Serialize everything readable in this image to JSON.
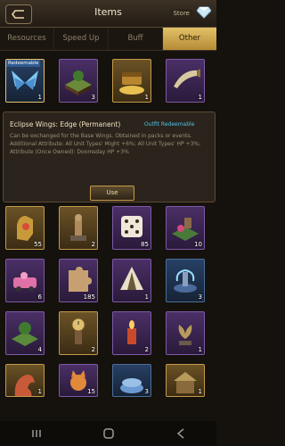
{
  "header": {
    "title": "Items",
    "store_label": "Store"
  },
  "tabs": [
    {
      "label": "Resources",
      "active": false
    },
    {
      "label": "Speed Up",
      "active": false
    },
    {
      "label": "Buff",
      "active": false
    },
    {
      "label": "Other",
      "active": true
    }
  ],
  "top_row": [
    {
      "name": "eclipse-wings-item",
      "count": "1",
      "badge": "Redeemable",
      "style": "blue",
      "icon": "wings-icon"
    },
    {
      "name": "island-decoration-item",
      "count": "3",
      "style": "purple",
      "icon": "island-icon"
    },
    {
      "name": "treasure-chest-item",
      "count": "1",
      "style": "gold",
      "icon": "treasure-icon"
    },
    {
      "name": "horn-item",
      "count": "1",
      "style": "purple",
      "icon": "horn-icon"
    }
  ],
  "detail": {
    "title": "Eclipse Wings: Edge (Permanent)",
    "badge": "Outfit Redeemable",
    "description": "Can be exchanged for the Base Wings. Obtained in packs or events.",
    "attributes": "Additional Attribute: All Unit Types' Might +6%; All Unit Types' HP +3%; Attribute (Once Owned): Doomsday HP +3%",
    "use_label": "Use"
  },
  "grid": [
    {
      "name": "gauntlet-item",
      "count": "55",
      "style": "gold",
      "icon": "gauntlet-icon"
    },
    {
      "name": "bunny-statue-item",
      "count": "2",
      "style": "gold",
      "icon": "statue-icon"
    },
    {
      "name": "dice-item",
      "count": "85",
      "style": "purple",
      "icon": "dice-icon"
    },
    {
      "name": "garden-item",
      "count": "10",
      "style": "purple",
      "icon": "garden-icon"
    },
    {
      "name": "flower-car-item",
      "count": "6",
      "style": "purple",
      "icon": "car-icon"
    },
    {
      "name": "puzzle-item",
      "count": "185",
      "style": "purple",
      "icon": "puzzle-icon"
    },
    {
      "name": "tent-item",
      "count": "1",
      "style": "purple",
      "icon": "tent-icon"
    },
    {
      "name": "fountain-item",
      "count": "3",
      "style": "blue",
      "icon": "fountain-icon"
    },
    {
      "name": "tree-island-item",
      "count": "4",
      "style": "purple",
      "icon": "island-icon"
    },
    {
      "name": "clock-statue-item",
      "count": "2",
      "style": "gold",
      "icon": "clock-icon"
    },
    {
      "name": "candle-item",
      "count": "2",
      "style": "purple",
      "icon": "candle-icon"
    },
    {
      "name": "bird-statue-item",
      "count": "1",
      "style": "purple",
      "icon": "bird-icon"
    },
    {
      "name": "dragon-statue-item",
      "count": "1",
      "style": "gold",
      "icon": "dragon-icon"
    },
    {
      "name": "fox-item",
      "count": "15",
      "style": "purple",
      "icon": "fox-icon"
    },
    {
      "name": "blue-cake-item",
      "count": "3",
      "style": "blue",
      "icon": "cake-icon"
    },
    {
      "name": "shrine-item",
      "count": "1",
      "style": "gold",
      "icon": "shrine-icon"
    }
  ],
  "colors": {
    "accent": "#c29a48",
    "tab_active": "#d8b35a",
    "badge_blue": "#4fc3e8"
  }
}
